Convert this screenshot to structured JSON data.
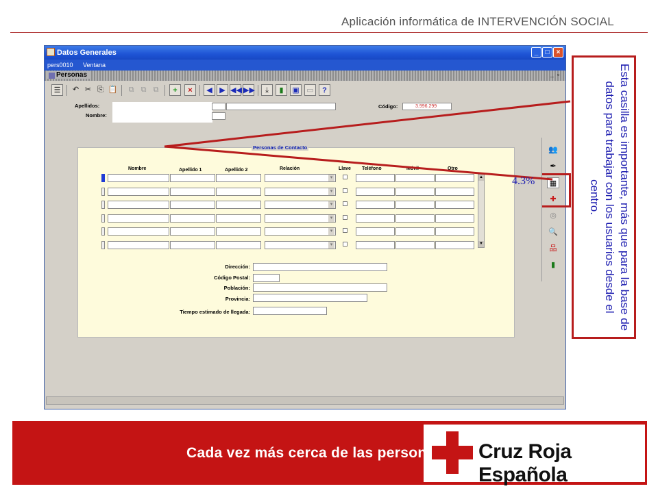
{
  "header": {
    "title": "Aplicación informática de INTERVENCIÓN SOCIAL"
  },
  "window": {
    "title": "Datos Generales",
    "menu": [
      "pers0010",
      "Ventana"
    ],
    "form_title": "Personas"
  },
  "form": {
    "apellidos_label": "Apellidos:",
    "nombre_label": "Nombre:",
    "codigo_label": "Código:",
    "codigo_value": "3.996.299"
  },
  "contacts": {
    "title": "Personas de Contacto",
    "columns": [
      "Nombre",
      "Apellido 1",
      "Apellido 2",
      "Relación",
      "Llave",
      "Teléfono",
      "Móvil",
      "Otro"
    ],
    "row_count": 6
  },
  "address": {
    "direccion_label": "Dirección:",
    "codigo_postal_label": "Código Postal:",
    "poblacion_label": "Población:",
    "provincia_label": "Provincia:",
    "tiempo_label": "Tiempo estimado de llegada:"
  },
  "annotation": {
    "text": "Esta casilla es importante, más que para la base de datos para trabajar con los usuarios desde el centro.",
    "percent": "4.3%"
  },
  "footer": {
    "slogan": "Cada vez más cerca de las personas",
    "brand": "Cruz Roja Española"
  },
  "colors": {
    "accent_red": "#c41414",
    "titlebar_blue": "#1e54d5",
    "annotation_blue": "#1e1eb0"
  }
}
